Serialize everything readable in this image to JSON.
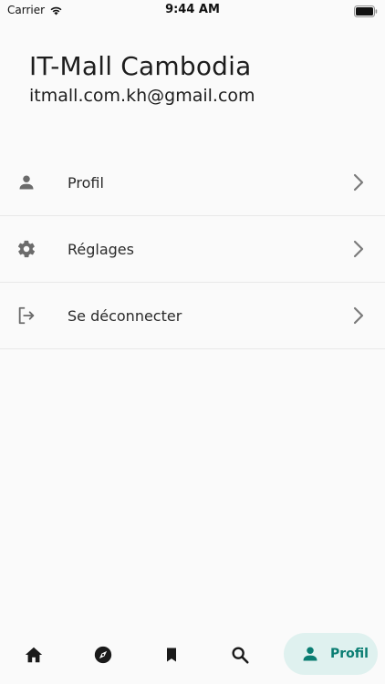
{
  "status_bar": {
    "carrier": "Carrier",
    "time": "9:44 AM"
  },
  "header": {
    "title": "IT-Mall Cambodia",
    "email": "itmall.com.kh@gmail.com"
  },
  "menu": {
    "items": [
      {
        "label": "Profil",
        "icon": "person-icon"
      },
      {
        "label": "Réglages",
        "icon": "gear-icon"
      },
      {
        "label": "Se déconnecter",
        "icon": "logout-icon"
      }
    ]
  },
  "bottom_nav": {
    "items": [
      {
        "icon": "home-icon"
      },
      {
        "icon": "compass-icon"
      },
      {
        "icon": "bookmark-icon"
      },
      {
        "icon": "search-icon"
      },
      {
        "icon": "person-icon",
        "label": "Profil",
        "active": true
      }
    ]
  },
  "colors": {
    "accent": "#0a7d72",
    "accent_bg": "#dff1ef",
    "icon_gray": "#6b6b6b",
    "chevron_gray": "#7a7a7a"
  }
}
